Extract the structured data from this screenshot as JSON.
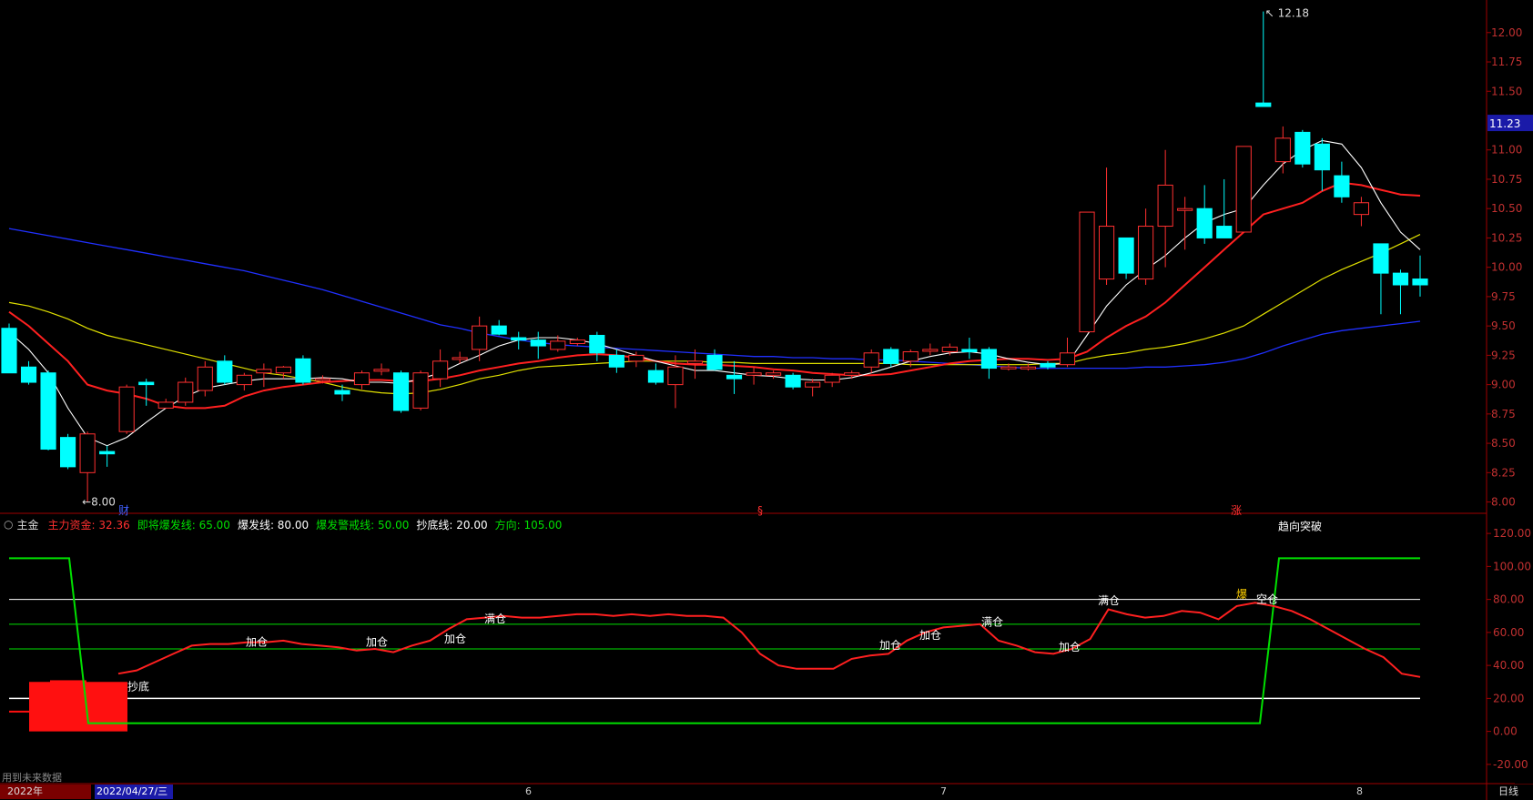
{
  "top_ylabels": [
    "12.00",
    "11.75",
    "11.50",
    "11.00",
    "10.75",
    "10.50",
    "10.25",
    "10.00",
    "9.75",
    "9.50",
    "9.25",
    "9.00",
    "8.75",
    "8.50",
    "8.25",
    "8.00"
  ],
  "bottom_ylabels": [
    "120.00",
    "100.00",
    "80.00",
    "60.00",
    "40.00",
    "20.00",
    "0.00",
    "-20.00"
  ],
  "current_price": "11.23",
  "max_label": "12.18",
  "min_label": "8.00",
  "markers": {
    "left": "财",
    "mid": "§",
    "right": "涨"
  },
  "indicator": {
    "name": "主金",
    "fields": [
      {
        "label": "主力资金: 32.36",
        "color": "#ff3030"
      },
      {
        "label": "即将爆发线: 65.00",
        "color": "#00e000"
      },
      {
        "label": "爆发线: 80.00",
        "color": "#ffffff"
      },
      {
        "label": "爆发警戒线: 50.00",
        "color": "#00e000"
      },
      {
        "label": "抄底线: 20.00",
        "color": "#ffffff"
      },
      {
        "label": "方向: 105.00",
        "color": "#00e000"
      }
    ]
  },
  "signals": {
    "chaodi": "抄底",
    "jiacang": "加仓",
    "mancang": "满仓",
    "bao": "爆",
    "kongcang": "空仓",
    "trend": "趋向突破"
  },
  "footer": {
    "note": "用到未来数据",
    "year": "2022年",
    "date": "2022/04/27/三",
    "m6": "6",
    "m7": "7",
    "m8": "8",
    "period": "日线"
  },
  "colors": {
    "up": "#ff3030",
    "down": "#00ffff",
    "ma5": "#ffffff",
    "ma10": "#ff2020",
    "ma20": "#e0e000",
    "ma60": "#2030ff",
    "line_main": "#ff2020",
    "green": "#00e000"
  },
  "chart_data": {
    "type": "candlestick",
    "ylim": [
      7.95,
      12.2
    ],
    "candles": [
      [
        9.48,
        9.1,
        9.52,
        9.1
      ],
      [
        9.15,
        9.02,
        9.2,
        9.0
      ],
      [
        9.1,
        8.45,
        9.12,
        8.44
      ],
      [
        8.55,
        8.3,
        8.58,
        8.28
      ],
      [
        8.25,
        8.58,
        8.6,
        8.0
      ],
      [
        8.43,
        8.41,
        8.48,
        8.3
      ],
      [
        8.6,
        8.98,
        9.0,
        8.58
      ],
      [
        9.02,
        9.0,
        9.05,
        8.82
      ],
      [
        8.8,
        8.85,
        8.88,
        8.8
      ],
      [
        8.85,
        9.02,
        9.06,
        8.82
      ],
      [
        8.95,
        9.15,
        9.2,
        8.9
      ],
      [
        9.2,
        9.02,
        9.25,
        9.0
      ],
      [
        9.0,
        9.08,
        9.1,
        8.95
      ],
      [
        9.1,
        9.13,
        9.18,
        8.98
      ],
      [
        9.1,
        9.15,
        9.16,
        9.05
      ],
      [
        9.22,
        9.02,
        9.25,
        9.0
      ],
      [
        9.05,
        9.05,
        9.08,
        9.01
      ],
      [
        8.95,
        8.92,
        9.0,
        8.86
      ],
      [
        9.0,
        9.1,
        9.12,
        8.96
      ],
      [
        9.12,
        9.13,
        9.18,
        9.08
      ],
      [
        9.1,
        8.78,
        9.12,
        8.76
      ],
      [
        8.8,
        9.1,
        9.12,
        8.78
      ],
      [
        9.05,
        9.2,
        9.3,
        8.98
      ],
      [
        9.22,
        9.23,
        9.28,
        9.18
      ],
      [
        9.3,
        9.5,
        9.58,
        9.2
      ],
      [
        9.5,
        9.43,
        9.55,
        9.42
      ],
      [
        9.4,
        9.38,
        9.45,
        9.3
      ],
      [
        9.38,
        9.33,
        9.45,
        9.22
      ],
      [
        9.3,
        9.37,
        9.42,
        9.28
      ],
      [
        9.35,
        9.38,
        9.4,
        9.33
      ],
      [
        9.42,
        9.27,
        9.45,
        9.2
      ],
      [
        9.25,
        9.15,
        9.3,
        9.1
      ],
      [
        9.2,
        9.25,
        9.28,
        9.15
      ],
      [
        9.12,
        9.02,
        9.18,
        9.0
      ],
      [
        9.0,
        9.15,
        9.25,
        8.8
      ],
      [
        9.18,
        9.2,
        9.3,
        9.05
      ],
      [
        9.25,
        9.13,
        9.3,
        9.12
      ],
      [
        9.08,
        9.05,
        9.2,
        8.92
      ],
      [
        9.08,
        9.1,
        9.15,
        9.0
      ],
      [
        9.08,
        9.1,
        9.12,
        9.05
      ],
      [
        9.08,
        8.98,
        9.1,
        8.96
      ],
      [
        8.98,
        9.02,
        9.05,
        8.9
      ],
      [
        9.02,
        9.08,
        9.1,
        8.98
      ],
      [
        9.08,
        9.1,
        9.12,
        9.05
      ],
      [
        9.15,
        9.27,
        9.3,
        9.1
      ],
      [
        9.3,
        9.18,
        9.32,
        9.15
      ],
      [
        9.2,
        9.28,
        9.3,
        9.15
      ],
      [
        9.3,
        9.3,
        9.35,
        9.25
      ],
      [
        9.28,
        9.32,
        9.35,
        9.25
      ],
      [
        9.3,
        9.28,
        9.4,
        9.22
      ],
      [
        9.3,
        9.14,
        9.32,
        9.05
      ],
      [
        9.15,
        9.15,
        9.18,
        9.12
      ],
      [
        9.14,
        9.15,
        9.18,
        9.12
      ],
      [
        9.18,
        9.15,
        9.2,
        9.13
      ],
      [
        9.17,
        9.27,
        9.4,
        9.15
      ],
      [
        9.45,
        10.47,
        10.47,
        9.45
      ],
      [
        9.9,
        10.35,
        10.85,
        9.85
      ],
      [
        10.25,
        9.95,
        10.25,
        9.9
      ],
      [
        9.9,
        10.35,
        10.5,
        9.85
      ],
      [
        10.35,
        10.7,
        11.0,
        10.0
      ],
      [
        10.5,
        10.5,
        10.6,
        10.15
      ],
      [
        10.5,
        10.25,
        10.7,
        10.2
      ],
      [
        10.35,
        10.25,
        10.75,
        10.25
      ],
      [
        10.3,
        11.03,
        11.03,
        10.3
      ],
      [
        11.4,
        11.37,
        12.18,
        11.37
      ],
      [
        10.9,
        11.1,
        11.2,
        10.8
      ],
      [
        11.15,
        10.88,
        11.17,
        10.85
      ],
      [
        11.05,
        10.83,
        11.1,
        10.65
      ],
      [
        10.78,
        10.6,
        10.9,
        10.55
      ],
      [
        10.45,
        10.55,
        10.6,
        10.35
      ],
      [
        10.2,
        9.95,
        10.2,
        9.6
      ],
      [
        9.95,
        9.85,
        9.98,
        9.6
      ],
      [
        9.9,
        9.85,
        10.1,
        9.75
      ]
    ],
    "ma5": [
      9.45,
      9.3,
      9.1,
      8.8,
      8.55,
      8.48,
      8.55,
      8.68,
      8.8,
      8.9,
      8.97,
      9.0,
      9.03,
      9.05,
      9.05,
      9.05,
      9.06,
      9.05,
      9.02,
      9.02,
      9.01,
      9.05,
      9.1,
      9.18,
      9.25,
      9.33,
      9.38,
      9.4,
      9.4,
      9.38,
      9.35,
      9.3,
      9.25,
      9.2,
      9.16,
      9.12,
      9.12,
      9.1,
      9.08,
      9.07,
      9.05,
      9.04,
      9.04,
      9.06,
      9.1,
      9.15,
      9.2,
      9.24,
      9.27,
      9.28,
      9.26,
      9.22,
      9.19,
      9.17,
      9.18,
      9.42,
      9.67,
      9.85,
      9.98,
      10.1,
      10.25,
      10.38,
      10.45,
      10.5,
      10.7,
      10.88,
      11.0,
      11.08,
      11.05,
      10.85,
      10.55,
      10.3,
      10.15
    ],
    "ma10": [
      9.62,
      9.5,
      9.35,
      9.2,
      9.0,
      8.95,
      8.92,
      8.88,
      8.82,
      8.8,
      8.8,
      8.82,
      8.9,
      8.95,
      8.98,
      9.0,
      9.02,
      9.03,
      9.04,
      9.04,
      9.03,
      9.03,
      9.05,
      9.08,
      9.12,
      9.15,
      9.18,
      9.2,
      9.23,
      9.25,
      9.26,
      9.25,
      9.23,
      9.2,
      9.18,
      9.17,
      9.17,
      9.16,
      9.15,
      9.13,
      9.12,
      9.1,
      9.09,
      9.08,
      9.08,
      9.09,
      9.12,
      9.15,
      9.18,
      9.2,
      9.21,
      9.22,
      9.22,
      9.21,
      9.22,
      9.28,
      9.4,
      9.5,
      9.58,
      9.7,
      9.85,
      10.0,
      10.15,
      10.3,
      10.45,
      10.5,
      10.55,
      10.65,
      10.72,
      10.7,
      10.66,
      10.62,
      10.61
    ],
    "ma20": [
      9.7,
      9.67,
      9.62,
      9.56,
      9.48,
      9.42,
      9.38,
      9.34,
      9.3,
      9.26,
      9.22,
      9.18,
      9.14,
      9.1,
      9.08,
      9.05,
      9.02,
      8.98,
      8.95,
      8.93,
      8.92,
      8.93,
      8.96,
      9.0,
      9.05,
      9.08,
      9.12,
      9.15,
      9.16,
      9.17,
      9.18,
      9.19,
      9.2,
      9.2,
      9.2,
      9.2,
      9.19,
      9.19,
      9.18,
      9.18,
      9.18,
      9.18,
      9.18,
      9.18,
      9.18,
      9.18,
      9.17,
      9.17,
      9.17,
      9.17,
      9.17,
      9.17,
      9.17,
      9.18,
      9.18,
      9.22,
      9.25,
      9.27,
      9.3,
      9.32,
      9.35,
      9.39,
      9.44,
      9.5,
      9.6,
      9.7,
      9.8,
      9.9,
      9.98,
      10.05,
      10.12,
      10.2,
      10.28
    ],
    "ma60": [
      10.33,
      10.3,
      10.27,
      10.24,
      10.21,
      10.18,
      10.15,
      10.12,
      10.09,
      10.06,
      10.03,
      10.0,
      9.97,
      9.93,
      9.89,
      9.85,
      9.81,
      9.76,
      9.71,
      9.66,
      9.61,
      9.56,
      9.51,
      9.48,
      9.44,
      9.41,
      9.38,
      9.36,
      9.34,
      9.33,
      9.32,
      9.31,
      9.3,
      9.29,
      9.28,
      9.27,
      9.26,
      9.25,
      9.24,
      9.24,
      9.23,
      9.23,
      9.22,
      9.22,
      9.21,
      9.21,
      9.2,
      9.19,
      9.18,
      9.17,
      9.16,
      9.15,
      9.14,
      9.14,
      9.14,
      9.14,
      9.14,
      9.14,
      9.15,
      9.15,
      9.16,
      9.17,
      9.19,
      9.22,
      9.27,
      9.33,
      9.38,
      9.43,
      9.46,
      9.48,
      9.5,
      9.52,
      9.54
    ],
    "indicator": {
      "ylim": [
        -30,
        130
      ],
      "main_flow": [
        12,
        11,
        12,
        15,
        18,
        25,
        35,
        37,
        42,
        47,
        52,
        53,
        53,
        54,
        54,
        55,
        53,
        52,
        51,
        49,
        50,
        48,
        52,
        55,
        62,
        68,
        69,
        70,
        69,
        69,
        70,
        71,
        71,
        70,
        71,
        70,
        71,
        70,
        70,
        69,
        60,
        47,
        40,
        38,
        38,
        38,
        44,
        46,
        47,
        55,
        60,
        63,
        64,
        65,
        55,
        52,
        48,
        47,
        50,
        56,
        74,
        71,
        69,
        70,
        73,
        72,
        68,
        76,
        78,
        76,
        73,
        68,
        62,
        56,
        50,
        45,
        35,
        33
      ],
      "direction": [
        105,
        105,
        105,
        105,
        5,
        5,
        5,
        5,
        5,
        5,
        5,
        5,
        5,
        5,
        5,
        5,
        5,
        5,
        5,
        5,
        5,
        5,
        5,
        5,
        5,
        5,
        5,
        5,
        5,
        5,
        5,
        5,
        5,
        5,
        5,
        5,
        5,
        5,
        5,
        5,
        5,
        5,
        5,
        5,
        5,
        5,
        5,
        5,
        5,
        5,
        5,
        5,
        5,
        5,
        5,
        5,
        5,
        5,
        5,
        5,
        5,
        5,
        5,
        5,
        5,
        105,
        105,
        105,
        105,
        105,
        105,
        105,
        105,
        105
      ],
      "lines": [
        80,
        65,
        50,
        20
      ]
    }
  }
}
